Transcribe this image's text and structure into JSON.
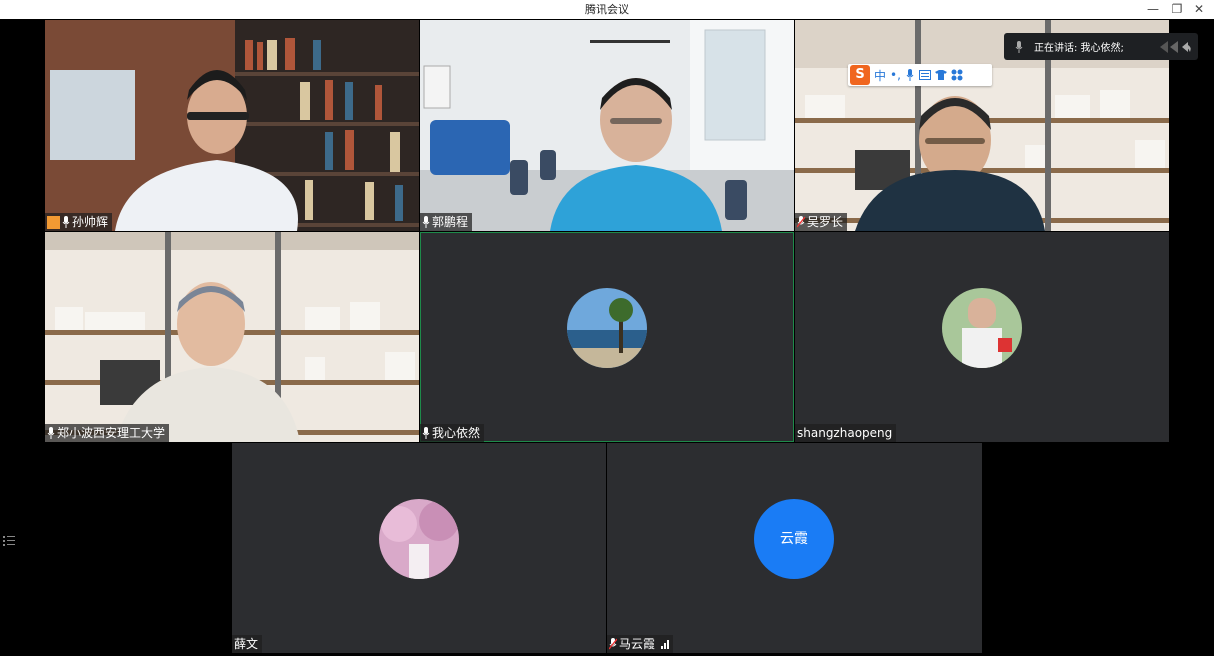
{
  "window": {
    "title": "腾讯会议",
    "minimize_icon": "—",
    "restore_icon": "❐",
    "close_icon": "✕"
  },
  "speaking_indicator": {
    "text": "正在讲话: 我心依然;"
  },
  "ime_toolbar": {
    "logo": "S",
    "mode": "中",
    "punct": "•,",
    "icons": [
      "mic-icon",
      "keyboard-icon",
      "skin-icon",
      "toolbox-icon"
    ]
  },
  "participants": [
    {
      "name": "孙帅辉",
      "host": true,
      "muted": false
    },
    {
      "name": "郭鹏程",
      "host": false,
      "muted": false
    },
    {
      "name": "吴罗长",
      "host": false,
      "muted": true
    },
    {
      "name": "郑小波西安理工大学",
      "host": false,
      "muted": false
    },
    {
      "name": "我心依然",
      "host": false,
      "muted": false
    },
    {
      "name": "shangzhaopeng",
      "host": false,
      "muted": false
    },
    {
      "name": "薛文",
      "host": false,
      "muted": false
    },
    {
      "name": "马云霞",
      "host": false,
      "muted": true,
      "avatar_text": "云霞"
    }
  ],
  "colors": {
    "tile_bg": "#2c2d30",
    "avatar_blue": "#1a7cf5",
    "speaking_border": "#1e8a4a",
    "host_orange": "#f29a33"
  }
}
